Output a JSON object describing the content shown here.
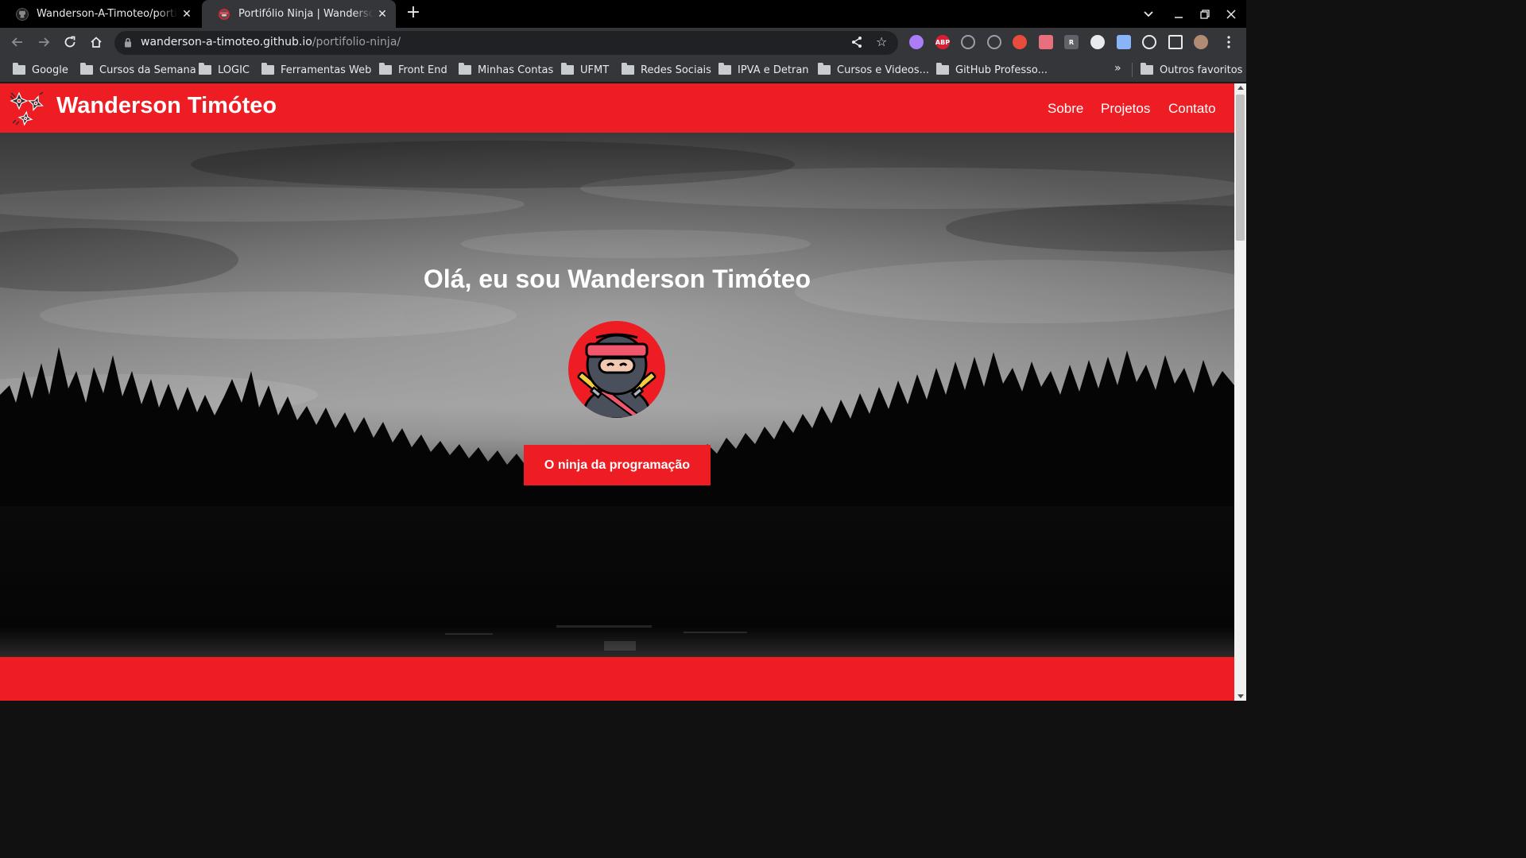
{
  "browser": {
    "tabs": [
      {
        "title": "Wanderson-A-Timoteo/portifolio-ninja",
        "favicon": "github-icon",
        "active": false
      },
      {
        "title": "Portifólio Ninja | Wanderson Timóteo",
        "favicon": "ninja-favicon",
        "active": true
      }
    ],
    "address_bar": {
      "host": "wanderson-a-timoteo.github.io",
      "path": "/portifolio-ninja/"
    },
    "extensions": [
      {
        "name": "blocker-icon",
        "label": "",
        "color": "#ab7df8"
      },
      {
        "name": "adblock-plus-icon",
        "label": "ABP",
        "color": "#d61e35"
      },
      {
        "name": "react-devtools-icon",
        "label": "",
        "color": "#9aa0a6"
      },
      {
        "name": "gear-extension-icon",
        "label": "",
        "color": "#9aa0a6"
      },
      {
        "name": "color-picker-icon",
        "label": "",
        "color": "#e74c3c"
      },
      {
        "name": "arrow-extension-icon",
        "label": "",
        "color": "#e8707e"
      },
      {
        "name": "reader-icon",
        "label": "R",
        "color": "#5f6368"
      },
      {
        "name": "circle-extension-icon",
        "label": "",
        "color": "#e8eaed"
      },
      {
        "name": "clipboard-extension-icon",
        "label": "",
        "color": "#8ab4f8"
      },
      {
        "name": "puzzle-icon",
        "label": "",
        "color": "#e8eaed"
      },
      {
        "name": "sidebar-icon",
        "label": "",
        "color": "#e8eaed"
      },
      {
        "name": "profile-avatar",
        "label": "",
        "color": "#b08c74"
      }
    ],
    "bookmarks": [
      "Google",
      "Cursos da Semana",
      "LOGIC",
      "Ferramentas Web",
      "Front End",
      "Minhas Contas",
      "UFMT",
      "Redes Sociais",
      "IPVA e Detran",
      "Cursos e Videos...",
      "GitHub Professo..."
    ],
    "bookmarks_overflow": "»",
    "other_bookmarks": "Outros favoritos"
  },
  "site": {
    "name": "Wanderson Timóteo",
    "nav": [
      "Sobre",
      "Projetos",
      "Contato"
    ],
    "hero_title": "Olá, eu sou Wanderson Timóteo",
    "cta_label": "O ninja da programação",
    "colors": {
      "brand_red": "#ee1d24",
      "text": "#ffffff"
    }
  }
}
